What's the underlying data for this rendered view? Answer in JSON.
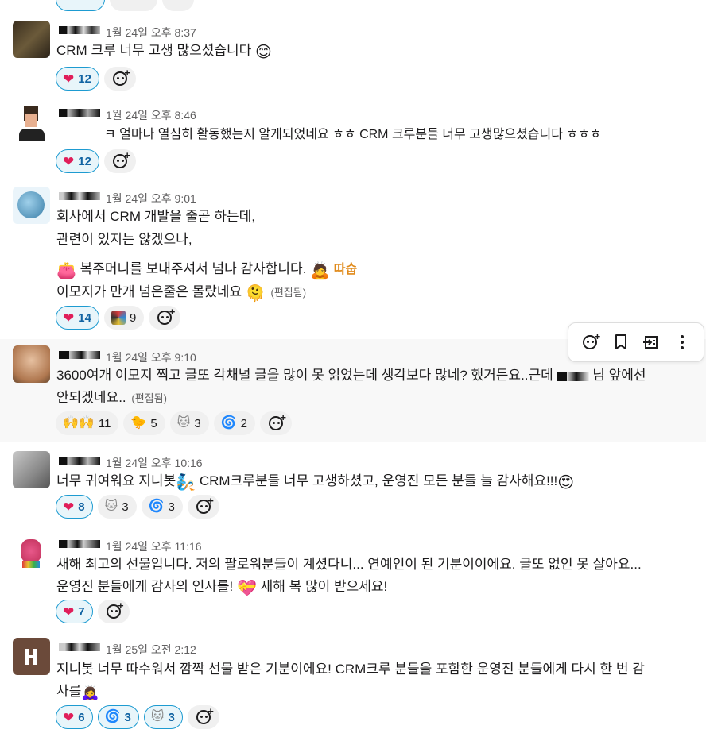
{
  "messages": [
    {
      "id": "m1",
      "timestamp": "1월 24일 오후 8:37",
      "lines": [
        "CRM 크루 너무 고생 많으셨습니다"
      ],
      "reactions": [
        {
          "emoji": "heart",
          "count": "12",
          "mine": true
        }
      ]
    },
    {
      "id": "m2",
      "timestamp": "1월 24일 오후 8:46",
      "lines": [
        "ㅋ 얼마나 열심히 활동했는지 알게되었네요 ㅎㅎ CRM 크루분들 너무 고생많으셨습니다 ㅎㅎㅎ"
      ],
      "reactions": [
        {
          "emoji": "heart",
          "count": "12",
          "mine": true
        }
      ]
    },
    {
      "id": "m3",
      "timestamp": "1월 24일 오후 9:01",
      "lines": [
        "회사에서 CRM 개발을 줄곧 하는데,",
        "관련이 있지는 않겠으나,",
        "복주머니를 보내주셔서 넘나 감사합니다.",
        "이모지가 만개 넘은줄은 몰랐네요"
      ],
      "edited": "(편집됨)",
      "emoji_text": "따숩",
      "reactions": [
        {
          "emoji": "heart",
          "count": "14",
          "mine": true
        },
        {
          "emoji": "custom",
          "count": "9",
          "mine": false
        }
      ]
    },
    {
      "id": "m4",
      "timestamp": "1월 24일 오후 9:10",
      "lines": [
        "3600여개 이모지 찍고 글또 각채널 글을 많이 못 읽었는데 생각보다 많네? 했거든요..근데",
        "님 앞에선",
        "안되겠네요.."
      ],
      "edited": "(편집됨)",
      "reactions": [
        {
          "emoji": "raised-hands",
          "count": "11",
          "mine": false
        },
        {
          "emoji": "custom-yellow",
          "count": "5",
          "mine": false
        },
        {
          "emoji": "custom-gray",
          "count": "3",
          "mine": false
        },
        {
          "emoji": "custom-gray2",
          "count": "2",
          "mine": false
        }
      ]
    },
    {
      "id": "m5",
      "timestamp": "1월 24일 오후 10:16",
      "lines": [
        "너무 귀여워요 지니봇",
        "CRM크루분들 너무 고생하셨고, 운영진 모든 분들 늘 감사해요!!!"
      ],
      "reactions": [
        {
          "emoji": "heart",
          "count": "8",
          "mine": true
        },
        {
          "emoji": "custom-gray",
          "count": "3",
          "mine": false
        },
        {
          "emoji": "custom-gray2",
          "count": "3",
          "mine": false
        }
      ]
    },
    {
      "id": "m6",
      "timestamp": "1월 24일 오후 11:16",
      "lines": [
        "새해 최고의 선물입니다. 저의 팔로워분들이 계셨다니... 연예인이 된 기분이이에요. 글또 없인 못 살아요...",
        "운영진 분들에게 감사의 인사를!",
        "새해 복 많이 받으세요!"
      ],
      "reactions": [
        {
          "emoji": "heart",
          "count": "7",
          "mine": true
        }
      ]
    },
    {
      "id": "m7",
      "timestamp": "1월 25일 오전 2:12",
      "lines": [
        "지니봇 너무 따수워서 깜짝 선물 받은 기분이에요! CRM크루 분들을 포함한 운영진 분들에게 다시 한 번 감",
        "사를"
      ],
      "reactions": [
        {
          "emoji": "heart",
          "count": "6",
          "mine": true
        },
        {
          "emoji": "custom-gray2",
          "count": "3",
          "mine": true
        },
        {
          "emoji": "custom-gray",
          "count": "3",
          "mine": true
        }
      ]
    }
  ],
  "toolbar": {
    "icons": [
      "add-reaction-icon",
      "bookmark-icon",
      "forward-icon",
      "more-icon"
    ]
  }
}
